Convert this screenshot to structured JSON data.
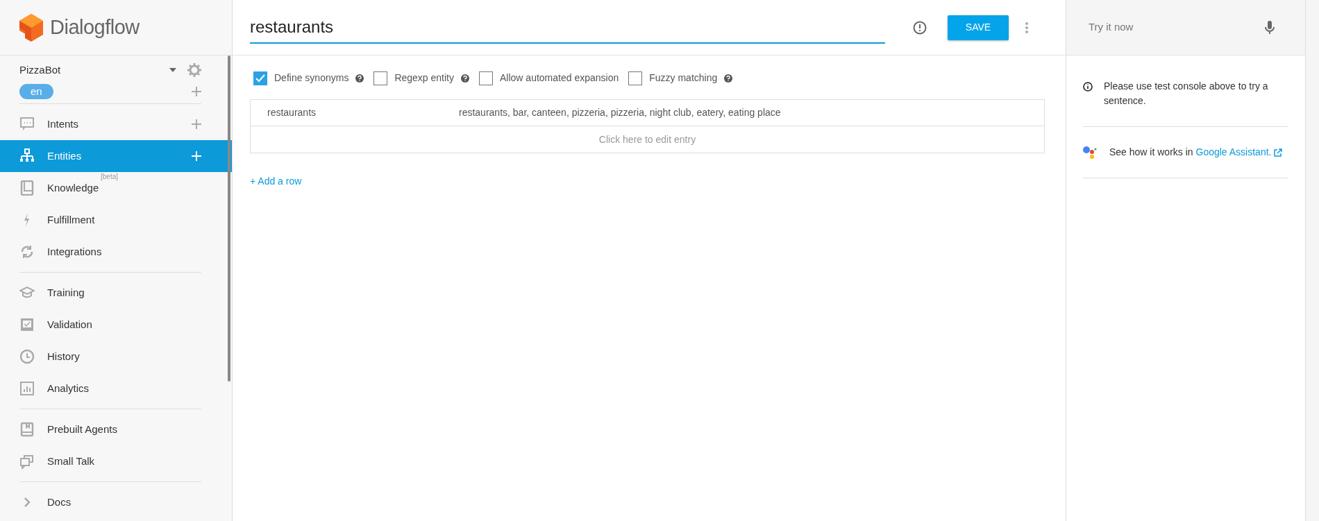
{
  "brand": {
    "name": "Dialogflow"
  },
  "agent": {
    "name": "PizzaBot",
    "language": "en"
  },
  "sidebar": {
    "sections": [
      {
        "items": [
          {
            "label": "Intents",
            "selected": false,
            "add": true
          },
          {
            "label": "Entities",
            "selected": true,
            "add": true
          },
          {
            "label": "Knowledge",
            "selected": false,
            "add": false,
            "tag": "[beta]"
          },
          {
            "label": "Fulfillment",
            "selected": false,
            "add": false
          },
          {
            "label": "Integrations",
            "selected": false,
            "add": false
          }
        ]
      },
      {
        "items": [
          {
            "label": "Training",
            "selected": false,
            "add": false
          },
          {
            "label": "Validation",
            "selected": false,
            "add": false
          },
          {
            "label": "History",
            "selected": false,
            "add": false
          },
          {
            "label": "Analytics",
            "selected": false,
            "add": false
          }
        ]
      },
      {
        "items": [
          {
            "label": "Prebuilt Agents",
            "selected": false,
            "add": false
          },
          {
            "label": "Small Talk",
            "selected": false,
            "add": false
          }
        ]
      },
      {
        "items": [
          {
            "label": "Docs",
            "selected": false,
            "add": false
          }
        ]
      }
    ]
  },
  "entity": {
    "name": "restaurants",
    "save": "SAVE"
  },
  "options": [
    {
      "label": "Define synonyms",
      "checked": true,
      "help": true
    },
    {
      "label": "Regexp entity",
      "checked": false,
      "help": true
    },
    {
      "label": "Allow automated expansion",
      "checked": false,
      "help": false
    },
    {
      "label": "Fuzzy matching",
      "checked": false,
      "help": true
    }
  ],
  "table": {
    "rows": [
      {
        "value": "restaurants",
        "synonyms": "restaurants, bar, canteen, pizzeria, pizzeria, night club, eatery, eating place"
      }
    ],
    "placeholder": "Click here to edit entry"
  },
  "add_row": "+ Add a row",
  "console": {
    "placeholder": "Try it now",
    "info": "Please use test console above to try a sentence.",
    "assistant_text": "See how it works in",
    "assistant_link": "Google Assistant",
    "assistant_end": "."
  }
}
